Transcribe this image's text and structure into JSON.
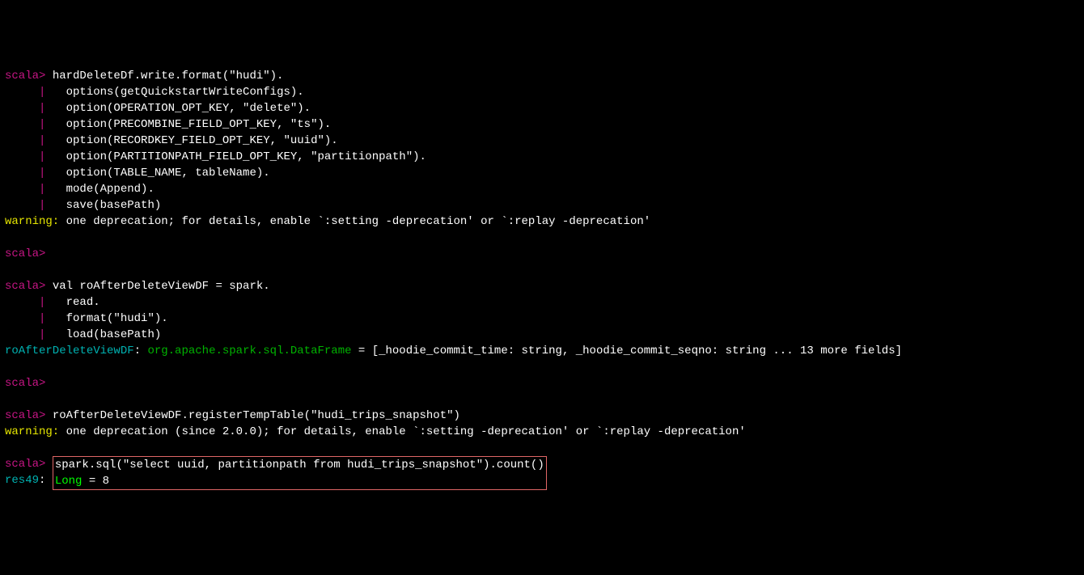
{
  "lines": [
    {
      "segments": [
        {
          "class": "prompt",
          "text": "scala> "
        },
        {
          "class": "white",
          "text": "hardDeleteDf.write.format(\"hudi\")."
        }
      ]
    },
    {
      "segments": [
        {
          "class": "white",
          "text": "     "
        },
        {
          "class": "pipe",
          "text": "|"
        },
        {
          "class": "white",
          "text": "   options(getQuickstartWriteConfigs)."
        }
      ]
    },
    {
      "segments": [
        {
          "class": "white",
          "text": "     "
        },
        {
          "class": "pipe",
          "text": "|"
        },
        {
          "class": "white",
          "text": "   option(OPERATION_OPT_KEY, \"delete\")."
        }
      ]
    },
    {
      "segments": [
        {
          "class": "white",
          "text": "     "
        },
        {
          "class": "pipe",
          "text": "|"
        },
        {
          "class": "white",
          "text": "   option(PRECOMBINE_FIELD_OPT_KEY, \"ts\")."
        }
      ]
    },
    {
      "segments": [
        {
          "class": "white",
          "text": "     "
        },
        {
          "class": "pipe",
          "text": "|"
        },
        {
          "class": "white",
          "text": "   option(RECORDKEY_FIELD_OPT_KEY, \"uuid\")."
        }
      ]
    },
    {
      "segments": [
        {
          "class": "white",
          "text": "     "
        },
        {
          "class": "pipe",
          "text": "|"
        },
        {
          "class": "white",
          "text": "   option(PARTITIONPATH_FIELD_OPT_KEY, \"partitionpath\")."
        }
      ]
    },
    {
      "segments": [
        {
          "class": "white",
          "text": "     "
        },
        {
          "class": "pipe",
          "text": "|"
        },
        {
          "class": "white",
          "text": "   option(TABLE_NAME, tableName)."
        }
      ]
    },
    {
      "segments": [
        {
          "class": "white",
          "text": "     "
        },
        {
          "class": "pipe",
          "text": "|"
        },
        {
          "class": "white",
          "text": "   mode(Append)."
        }
      ]
    },
    {
      "segments": [
        {
          "class": "white",
          "text": "     "
        },
        {
          "class": "pipe",
          "text": "|"
        },
        {
          "class": "white",
          "text": "   save(basePath)"
        }
      ]
    },
    {
      "segments": [
        {
          "class": "yellow",
          "text": "warning: "
        },
        {
          "class": "white",
          "text": "one deprecation; for details, enable `:setting -deprecation' or `:replay -deprecation'"
        }
      ]
    },
    {
      "segments": [
        {
          "class": "white",
          "text": ""
        }
      ]
    },
    {
      "segments": [
        {
          "class": "prompt",
          "text": "scala> "
        }
      ]
    },
    {
      "segments": [
        {
          "class": "white",
          "text": ""
        }
      ]
    },
    {
      "segments": [
        {
          "class": "prompt",
          "text": "scala> "
        },
        {
          "class": "white",
          "text": "val roAfterDeleteViewDF = spark."
        }
      ]
    },
    {
      "segments": [
        {
          "class": "white",
          "text": "     "
        },
        {
          "class": "pipe",
          "text": "|"
        },
        {
          "class": "white",
          "text": "   read."
        }
      ]
    },
    {
      "segments": [
        {
          "class": "white",
          "text": "     "
        },
        {
          "class": "pipe",
          "text": "|"
        },
        {
          "class": "white",
          "text": "   format(\"hudi\")."
        }
      ]
    },
    {
      "segments": [
        {
          "class": "white",
          "text": "     "
        },
        {
          "class": "pipe",
          "text": "|"
        },
        {
          "class": "white",
          "text": "   load(basePath)"
        }
      ]
    },
    {
      "segments": [
        {
          "class": "teal",
          "text": "roAfterDeleteViewDF"
        },
        {
          "class": "white",
          "text": ": "
        },
        {
          "class": "green",
          "text": "org.apache.spark.sql.DataFrame"
        },
        {
          "class": "white",
          "text": " = [_hoodie_commit_time: string, _hoodie_commit_seqno: string ... 13 more fields]"
        }
      ]
    },
    {
      "segments": [
        {
          "class": "white",
          "text": ""
        }
      ]
    },
    {
      "segments": [
        {
          "class": "prompt",
          "text": "scala> "
        }
      ]
    },
    {
      "segments": [
        {
          "class": "white",
          "text": ""
        }
      ]
    },
    {
      "segments": [
        {
          "class": "prompt",
          "text": "scala> "
        },
        {
          "class": "white",
          "text": "roAfterDeleteViewDF.registerTempTable(\"hudi_trips_snapshot\")"
        }
      ]
    },
    {
      "segments": [
        {
          "class": "yellow",
          "text": "warning: "
        },
        {
          "class": "white",
          "text": "one deprecation (since 2.0.0); for details, enable `:setting -deprecation' or `:replay -deprecation'"
        }
      ]
    },
    {
      "segments": [
        {
          "class": "white",
          "text": ""
        }
      ]
    }
  ],
  "boxed": {
    "line1": {
      "prompt": "scala> ",
      "cmd": "spark.sql(\"select uuid, partitionpath from hudi_trips_snapshot\").count()"
    },
    "line2": {
      "res": "res49",
      "sep": ": ",
      "type": "Long",
      "rest": " = 8"
    }
  }
}
